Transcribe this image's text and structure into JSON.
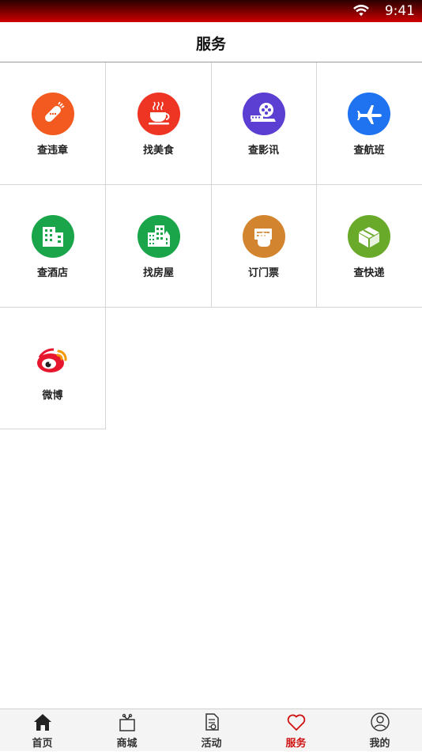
{
  "status_bar": {
    "time": "9:41"
  },
  "header": {
    "title": "服务"
  },
  "services": [
    {
      "label": "查违章",
      "icon": "bandage-icon",
      "color": "#f25a1f"
    },
    {
      "label": "找美食",
      "icon": "coffee-cup-icon",
      "color": "#ee3524"
    },
    {
      "label": "查影讯",
      "icon": "film-reel-icon",
      "color": "#5b3fd2"
    },
    {
      "label": "查航班",
      "icon": "airplane-icon",
      "color": "#1f73f0"
    },
    {
      "label": "查酒店",
      "icon": "hotel-building-icon",
      "color": "#1aa54a"
    },
    {
      "label": "找房屋",
      "icon": "buildings-icon",
      "color": "#1aa54a"
    },
    {
      "label": "订门票",
      "icon": "ticket-icon",
      "color": "#d2842f"
    },
    {
      "label": "查快递",
      "icon": "package-box-icon",
      "color": "#6aaa2a"
    },
    {
      "label": "微博",
      "icon": "weibo-icon",
      "color": "#e6162d"
    }
  ],
  "tabbar": {
    "items": [
      {
        "label": "首页",
        "icon": "home-icon"
      },
      {
        "label": "商城",
        "icon": "gift-box-icon"
      },
      {
        "label": "活动",
        "icon": "document-icon"
      },
      {
        "label": "服务",
        "icon": "heart-icon",
        "active": true
      },
      {
        "label": "我的",
        "icon": "user-profile-icon"
      }
    ]
  }
}
